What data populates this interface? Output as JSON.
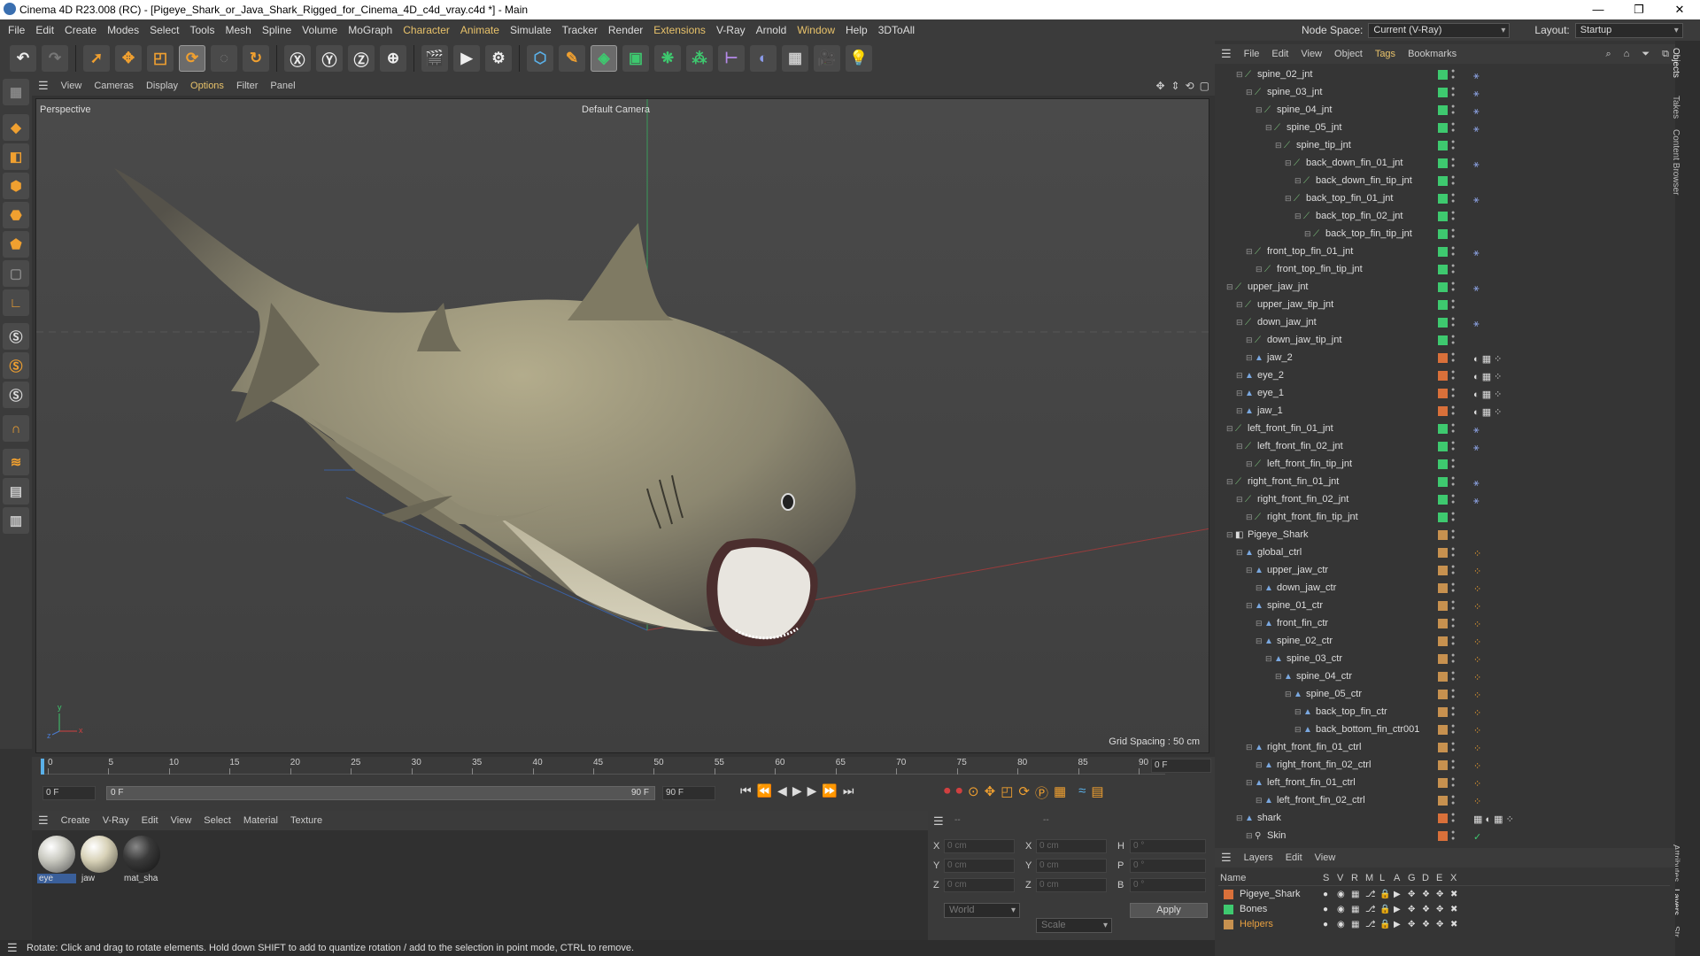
{
  "window": {
    "title": "Cinema 4D R23.008 (RC) - [Pigeye_Shark_or_Java_Shark_Rigged_for_Cinema_4D_c4d_vray.c4d *] - Main",
    "minimize": "—",
    "maximize": "❐",
    "close": "✕"
  },
  "menubar": [
    "File",
    "Edit",
    "Create",
    "Modes",
    "Select",
    "Tools",
    "Mesh",
    "Spline",
    "Volume",
    "MoGraph",
    "Character",
    "Animate",
    "Simulate",
    "Tracker",
    "Render",
    "Extensions",
    "V-Ray",
    "Arnold",
    "Window",
    "Help",
    "3DToAll"
  ],
  "nodespace": {
    "label": "Node Space:",
    "value": "Current (V-Ray)",
    "layout_label": "Layout:",
    "layout_value": "Startup"
  },
  "viewport": {
    "menu": [
      "View",
      "Cameras",
      "Display",
      "Options",
      "Filter",
      "Panel"
    ],
    "name": "Perspective",
    "camera": "Default Camera",
    "grid_spacing": "Grid Spacing : 50 cm",
    "axis_y": "y",
    "axis_x": "x",
    "axis_z": "z"
  },
  "timeline": {
    "ticks": [
      "0",
      "5",
      "10",
      "15",
      "20",
      "25",
      "30",
      "35",
      "40",
      "45",
      "50",
      "55",
      "60",
      "65",
      "70",
      "75",
      "80",
      "85",
      "90"
    ],
    "end_frame_field": "0 F",
    "start_field": "0 F",
    "current_field": "0 F",
    "range_end": "90 F",
    "range_end_field": "90 F"
  },
  "materials": {
    "menu": [
      "Create",
      "V-Ray",
      "Edit",
      "View",
      "Select",
      "Material",
      "Texture"
    ],
    "items": [
      {
        "label": "eye",
        "color": "#c9c9c0"
      },
      {
        "label": "jaw",
        "color": "#d8d2b8"
      },
      {
        "label": "mat_sha",
        "color": "#3a3a3a"
      }
    ]
  },
  "coords": {
    "x_label": "X",
    "y_label": "Y",
    "z_label": "Z",
    "h_label": "H",
    "p_label": "P",
    "b_label": "B",
    "pos_x": "0 cm",
    "pos_y": "0 cm",
    "pos_z": "0 cm",
    "size_x": "0 cm",
    "size_y": "0 cm",
    "size_z": "0 cm",
    "rot_h": "0 °",
    "rot_p": "0 °",
    "rot_b": "0 °",
    "mode1": "World",
    "mode2": "Scale",
    "apply": "Apply",
    "dash1": "--",
    "dash2": "--"
  },
  "objects_menu": [
    "File",
    "Edit",
    "View",
    "Object",
    "Tags",
    "Bookmarks"
  ],
  "objects": [
    {
      "name": "spine_02_jnt",
      "depth": 2,
      "tag": "#3ec96f",
      "icon": "j",
      "k": "ik"
    },
    {
      "name": "spine_03_jnt",
      "depth": 3,
      "tag": "#3ec96f",
      "icon": "j",
      "k": "ik"
    },
    {
      "name": "spine_04_jnt",
      "depth": 4,
      "tag": "#3ec96f",
      "icon": "j",
      "k": "ik"
    },
    {
      "name": "spine_05_jnt",
      "depth": 5,
      "tag": "#3ec96f",
      "icon": "j",
      "k": "ik"
    },
    {
      "name": "spine_tip_jnt",
      "depth": 6,
      "tag": "#3ec96f",
      "icon": "j",
      "k": ""
    },
    {
      "name": "back_down_fin_01_jnt",
      "depth": 7,
      "tag": "#3ec96f",
      "icon": "j",
      "k": "ik"
    },
    {
      "name": "back_down_fin_tip_jnt",
      "depth": 8,
      "tag": "#3ec96f",
      "icon": "j",
      "k": ""
    },
    {
      "name": "back_top_fin_01_jnt",
      "depth": 7,
      "tag": "#3ec96f",
      "icon": "j",
      "k": "ik"
    },
    {
      "name": "back_top_fin_02_jnt",
      "depth": 8,
      "tag": "#3ec96f",
      "icon": "j",
      "k": ""
    },
    {
      "name": "back_top_fin_tip_jnt",
      "depth": 9,
      "tag": "#3ec96f",
      "icon": "j",
      "k": ""
    },
    {
      "name": "front_top_fin_01_jnt",
      "depth": 3,
      "tag": "#3ec96f",
      "icon": "j",
      "k": "ik"
    },
    {
      "name": "front_top_fin_tip_jnt",
      "depth": 4,
      "tag": "#3ec96f",
      "icon": "j",
      "k": ""
    },
    {
      "name": "upper_jaw_jnt",
      "depth": 1,
      "tag": "#3ec96f",
      "icon": "j",
      "k": "ik"
    },
    {
      "name": "upper_jaw_tip_jnt",
      "depth": 2,
      "tag": "#3ec96f",
      "icon": "j",
      "k": ""
    },
    {
      "name": "down_jaw_jnt",
      "depth": 2,
      "tag": "#3ec96f",
      "icon": "j",
      "k": "ik"
    },
    {
      "name": "down_jaw_tip_jnt",
      "depth": 3,
      "tag": "#3ec96f",
      "icon": "j",
      "k": ""
    },
    {
      "name": "jaw_2",
      "depth": 3,
      "tag": "#d9703a",
      "icon": "m",
      "k": "mat"
    },
    {
      "name": "eye_2",
      "depth": 2,
      "tag": "#d9703a",
      "icon": "m",
      "k": "mat"
    },
    {
      "name": "eye_1",
      "depth": 2,
      "tag": "#d9703a",
      "icon": "m",
      "k": "mat"
    },
    {
      "name": "jaw_1",
      "depth": 2,
      "tag": "#d9703a",
      "icon": "m",
      "k": "mat"
    },
    {
      "name": "left_front_fin_01_jnt",
      "depth": 1,
      "tag": "#3ec96f",
      "icon": "j",
      "k": "ik"
    },
    {
      "name": "left_front_fin_02_jnt",
      "depth": 2,
      "tag": "#3ec96f",
      "icon": "j",
      "k": "ik"
    },
    {
      "name": "left_front_fin_tip_jnt",
      "depth": 3,
      "tag": "#3ec96f",
      "icon": "j",
      "k": ""
    },
    {
      "name": "right_front_fin_01_jnt",
      "depth": 1,
      "tag": "#3ec96f",
      "icon": "j",
      "k": "ik"
    },
    {
      "name": "right_front_fin_02_jnt",
      "depth": 2,
      "tag": "#3ec96f",
      "icon": "j",
      "k": "ik"
    },
    {
      "name": "right_front_fin_tip_jnt",
      "depth": 3,
      "tag": "#3ec96f",
      "icon": "j",
      "k": ""
    },
    {
      "name": "Pigeye_Shark",
      "depth": 1,
      "tag": "#c7914f",
      "icon": "n",
      "k": ""
    },
    {
      "name": "global_ctrl",
      "depth": 2,
      "tag": "#c7914f",
      "icon": "c",
      "k": "dot"
    },
    {
      "name": "upper_jaw_ctr",
      "depth": 3,
      "tag": "#c7914f",
      "icon": "c",
      "k": "dot"
    },
    {
      "name": "down_jaw_ctr",
      "depth": 4,
      "tag": "#c7914f",
      "icon": "c",
      "k": "dot"
    },
    {
      "name": "spine_01_ctr",
      "depth": 3,
      "tag": "#c7914f",
      "icon": "c",
      "k": "dot"
    },
    {
      "name": "front_fin_ctr",
      "depth": 4,
      "tag": "#c7914f",
      "icon": "c",
      "k": "dot"
    },
    {
      "name": "spine_02_ctr",
      "depth": 4,
      "tag": "#c7914f",
      "icon": "c",
      "k": "dot"
    },
    {
      "name": "spine_03_ctr",
      "depth": 5,
      "tag": "#c7914f",
      "icon": "c",
      "k": "dot"
    },
    {
      "name": "spine_04_ctr",
      "depth": 6,
      "tag": "#c7914f",
      "icon": "c",
      "k": "dot"
    },
    {
      "name": "spine_05_ctr",
      "depth": 7,
      "tag": "#c7914f",
      "icon": "c",
      "k": "dot"
    },
    {
      "name": "back_top_fin_ctr",
      "depth": 8,
      "tag": "#c7914f",
      "icon": "c",
      "k": "dot"
    },
    {
      "name": "back_bottom_fin_ctr001",
      "depth": 8,
      "tag": "#c7914f",
      "icon": "c",
      "k": "dot"
    },
    {
      "name": "right_front_fin_01_ctrl",
      "depth": 3,
      "tag": "#c7914f",
      "icon": "c",
      "k": "dot"
    },
    {
      "name": "right_front_fin_02_ctrl",
      "depth": 4,
      "tag": "#c7914f",
      "icon": "c",
      "k": "dot"
    },
    {
      "name": "left_front_fin_01_ctrl",
      "depth": 3,
      "tag": "#c7914f",
      "icon": "c",
      "k": "dot"
    },
    {
      "name": "left_front_fin_02_ctrl",
      "depth": 4,
      "tag": "#c7914f",
      "icon": "c",
      "k": "dot"
    },
    {
      "name": "shark",
      "depth": 2,
      "tag": "#d9703a",
      "icon": "c",
      "k": "mat3"
    },
    {
      "name": "Skin",
      "depth": 3,
      "tag": "#d9703a",
      "icon": "s",
      "k": "check"
    }
  ],
  "layers": {
    "menu": [
      "Layers",
      "Edit",
      "View"
    ],
    "columns": [
      "Name",
      "S",
      "V",
      "R",
      "M",
      "L",
      "A",
      "G",
      "D",
      "E",
      "X"
    ],
    "rows": [
      {
        "name": "Pigeye_Shark",
        "color": "#d9703a",
        "text_color": "#dddddd"
      },
      {
        "name": "Bones",
        "color": "#3ec96f",
        "text_color": "#dddddd"
      },
      {
        "name": "Helpers",
        "color": "#c7914f",
        "text_color": "#e8a040"
      }
    ]
  },
  "side_tabs": [
    "Objects",
    "Takes",
    "Content Browser",
    "Attributes",
    "Layers",
    "Str"
  ],
  "status": "Rotate: Click and drag to rotate elements. Hold down SHIFT to add to quantize rotation / add to the selection in point mode, CTRL to remove."
}
